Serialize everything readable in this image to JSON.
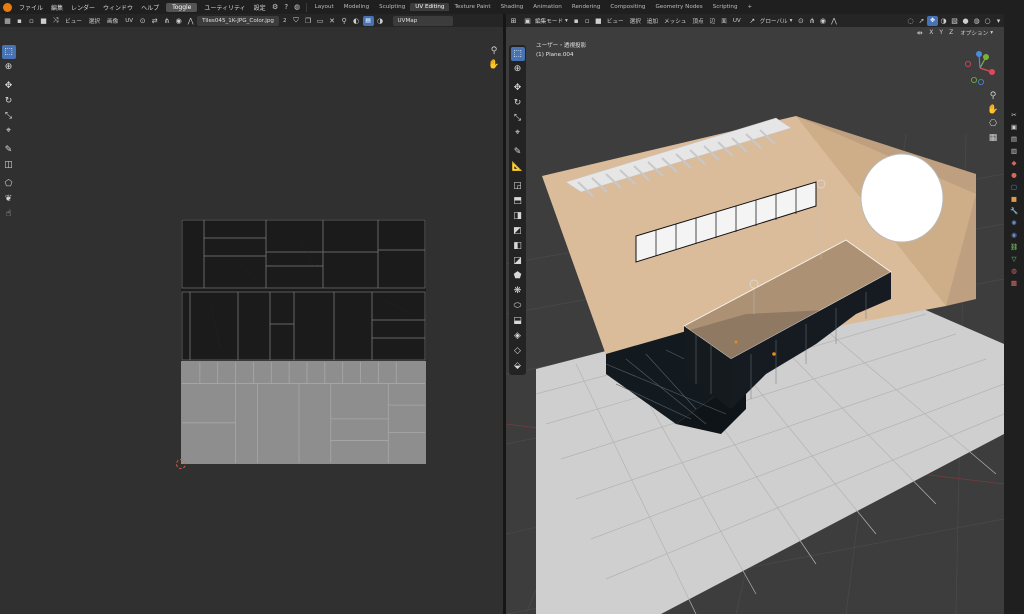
{
  "topbar": {
    "menus": [
      "ファイル",
      "編集",
      "レンダー",
      "ウィンドウ",
      "ヘルプ"
    ],
    "toggle_label": "Toggle",
    "extra_menus": [
      "ユーティリティ",
      "設定"
    ],
    "workspaces": [
      "Layout",
      "Modeling",
      "Sculpting",
      "UV Editing",
      "Texture Paint",
      "Shading",
      "Animation",
      "Rendering",
      "Compositing",
      "Geometry Nodes",
      "Scripting"
    ],
    "active_workspace": "UV Editing",
    "add_tab_label": "+"
  },
  "uv_editor": {
    "header": {
      "menus": [
        "ビュー",
        "選択",
        "画像",
        "UV"
      ],
      "image_name": "Tiles045_1K-JPG_Color.jpg",
      "user_count": "2",
      "uvmap_name": "UVMap"
    },
    "tools": [
      "select-box-icon",
      "cursor-icon",
      "move-icon",
      "rotate-icon",
      "scale-icon",
      "transform-icon",
      "annotate-icon",
      "rip-icon",
      "grab-icon",
      "relax-icon",
      "pinch-icon"
    ],
    "colors": {
      "background": "#303030",
      "selection": "#e07a1e",
      "dark_tiles": "#1b1b1b",
      "light_tiles": "#8e8e8e"
    }
  },
  "viewport": {
    "header": {
      "mode_label": "編集モード",
      "menus": [
        "ビュー",
        "選択",
        "追加",
        "メッシュ",
        "頂点",
        "辺",
        "面",
        "UV"
      ],
      "orientation": "グローバル",
      "options_label": "オプション",
      "axes": [
        "X",
        "Y",
        "Z"
      ]
    },
    "info_view": "ユーザー・透視投影",
    "info_object": "(1) Plane.004",
    "colors": {
      "wall": "#d9b996",
      "floor": "#c8c8c8",
      "counter_top": "#a58a6e",
      "window": "#ffffff",
      "grid": "#4a4a4a"
    }
  }
}
